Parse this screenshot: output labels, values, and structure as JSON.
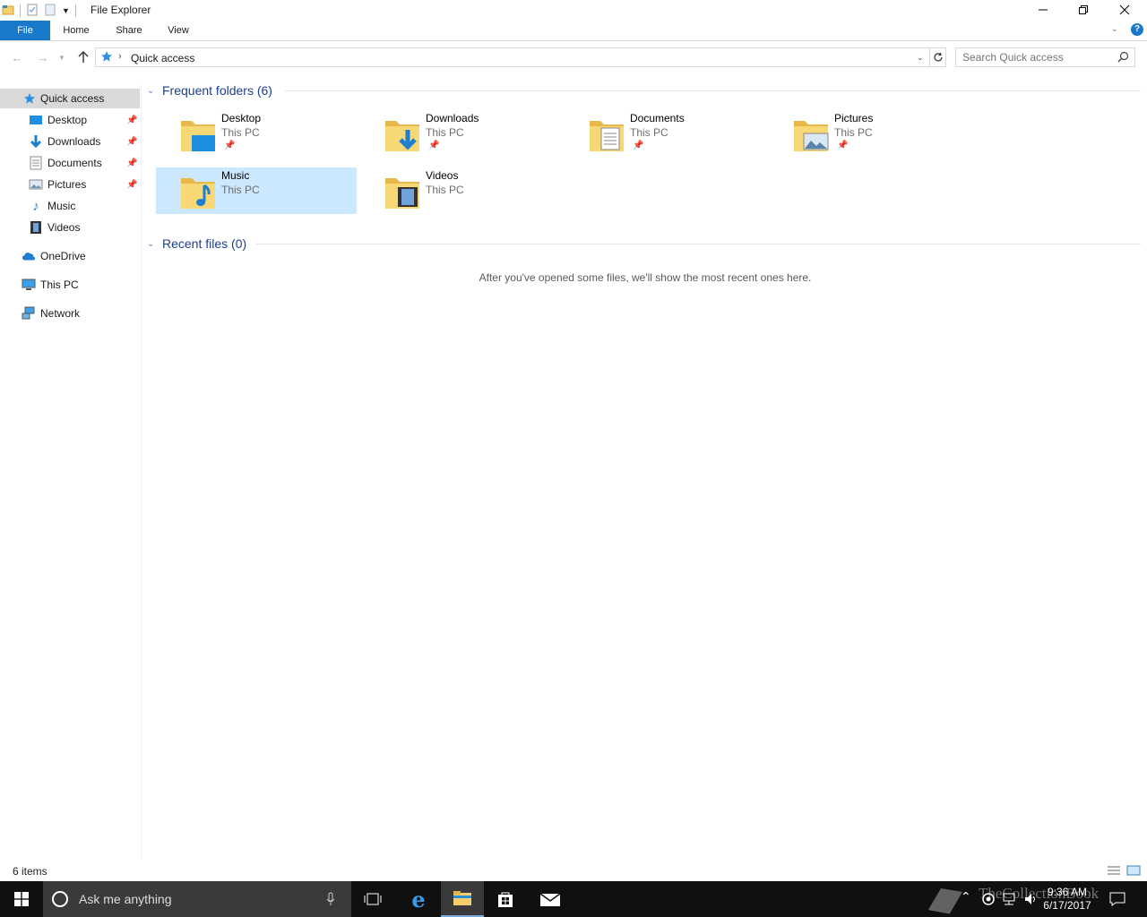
{
  "window": {
    "title": "File Explorer"
  },
  "ribbon": {
    "tabs": [
      "File",
      "Home",
      "Share",
      "View"
    ]
  },
  "address": {
    "path": "Quick access",
    "search_placeholder": "Search Quick access"
  },
  "navpane": {
    "quick_access": "Quick access",
    "items": [
      {
        "label": "Desktop",
        "icon": "desktop-icon",
        "pinned": true
      },
      {
        "label": "Downloads",
        "icon": "downloads-icon",
        "pinned": true
      },
      {
        "label": "Documents",
        "icon": "documents-icon",
        "pinned": true
      },
      {
        "label": "Pictures",
        "icon": "pictures-icon",
        "pinned": true
      },
      {
        "label": "Music",
        "icon": "music-icon",
        "pinned": false
      },
      {
        "label": "Videos",
        "icon": "videos-icon",
        "pinned": false
      }
    ],
    "onedrive": "OneDrive",
    "this_pc": "This PC",
    "network": "Network"
  },
  "content": {
    "frequent_header": "Frequent folders (6)",
    "recent_header": "Recent files (0)",
    "empty_message": "After you've opened some files, we'll show the most recent ones here.",
    "folders": [
      {
        "name": "Desktop",
        "location": "This PC",
        "pinned": true
      },
      {
        "name": "Downloads",
        "location": "This PC",
        "pinned": true
      },
      {
        "name": "Documents",
        "location": "This PC",
        "pinned": true
      },
      {
        "name": "Pictures",
        "location": "This PC",
        "pinned": true
      },
      {
        "name": "Music",
        "location": "This PC",
        "pinned": false,
        "selected": true
      },
      {
        "name": "Videos",
        "location": "This PC",
        "pinned": false
      }
    ]
  },
  "status": {
    "item_count": "6 items"
  },
  "taskbar": {
    "search_text": "Ask me anything",
    "time": "9:36 AM",
    "date": "6/17/2017",
    "watermark": "TheCollectionBook"
  },
  "colors": {
    "accent": "#1979ca",
    "selected": "#cce8ff",
    "header_blue": "#1e3d8f",
    "folder": "#f5cf6e"
  }
}
